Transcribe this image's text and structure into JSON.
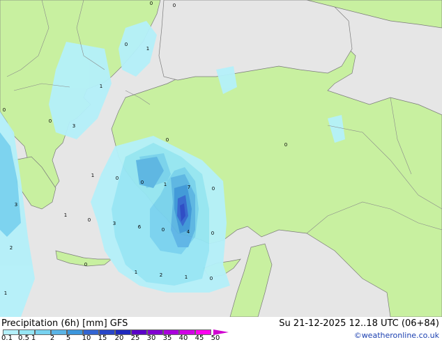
{
  "title": "Precipitation (6h) [mm] GFS",
  "date_text": "Su 21-12-2025 12..18 UTC (06+84)",
  "credit": "©weatheronline.co.uk",
  "legend": {
    "ticks": [
      "0.1",
      "0.5",
      "1",
      "2",
      "5",
      "10",
      "15",
      "20",
      "25",
      "30",
      "35",
      "40",
      "45",
      "50"
    ],
    "colors": [
      "#b4f0fa",
      "#96e6f5",
      "#78d2f0",
      "#5ab4e6",
      "#3c96dc",
      "#3264d2",
      "#2846c8",
      "#1e28be",
      "#5a00c8",
      "#8200d2",
      "#aa00dc",
      "#d200e6",
      "#ff00f0"
    ]
  },
  "colors": {
    "land": "#c8f0a0",
    "sea": "#e6e6e6",
    "border": "#8a8a8a",
    "coast": "#7a7a7a"
  },
  "map_labels": [
    "0",
    "0",
    "0",
    "1",
    "1",
    "0",
    "3",
    "0",
    "0",
    "0",
    "1",
    "0",
    "1",
    "7",
    "0",
    "0",
    "3",
    "1",
    "0",
    "3",
    "6",
    "0",
    "4",
    "0",
    "2",
    "1",
    "2",
    "1",
    "0",
    "0",
    "1"
  ]
}
